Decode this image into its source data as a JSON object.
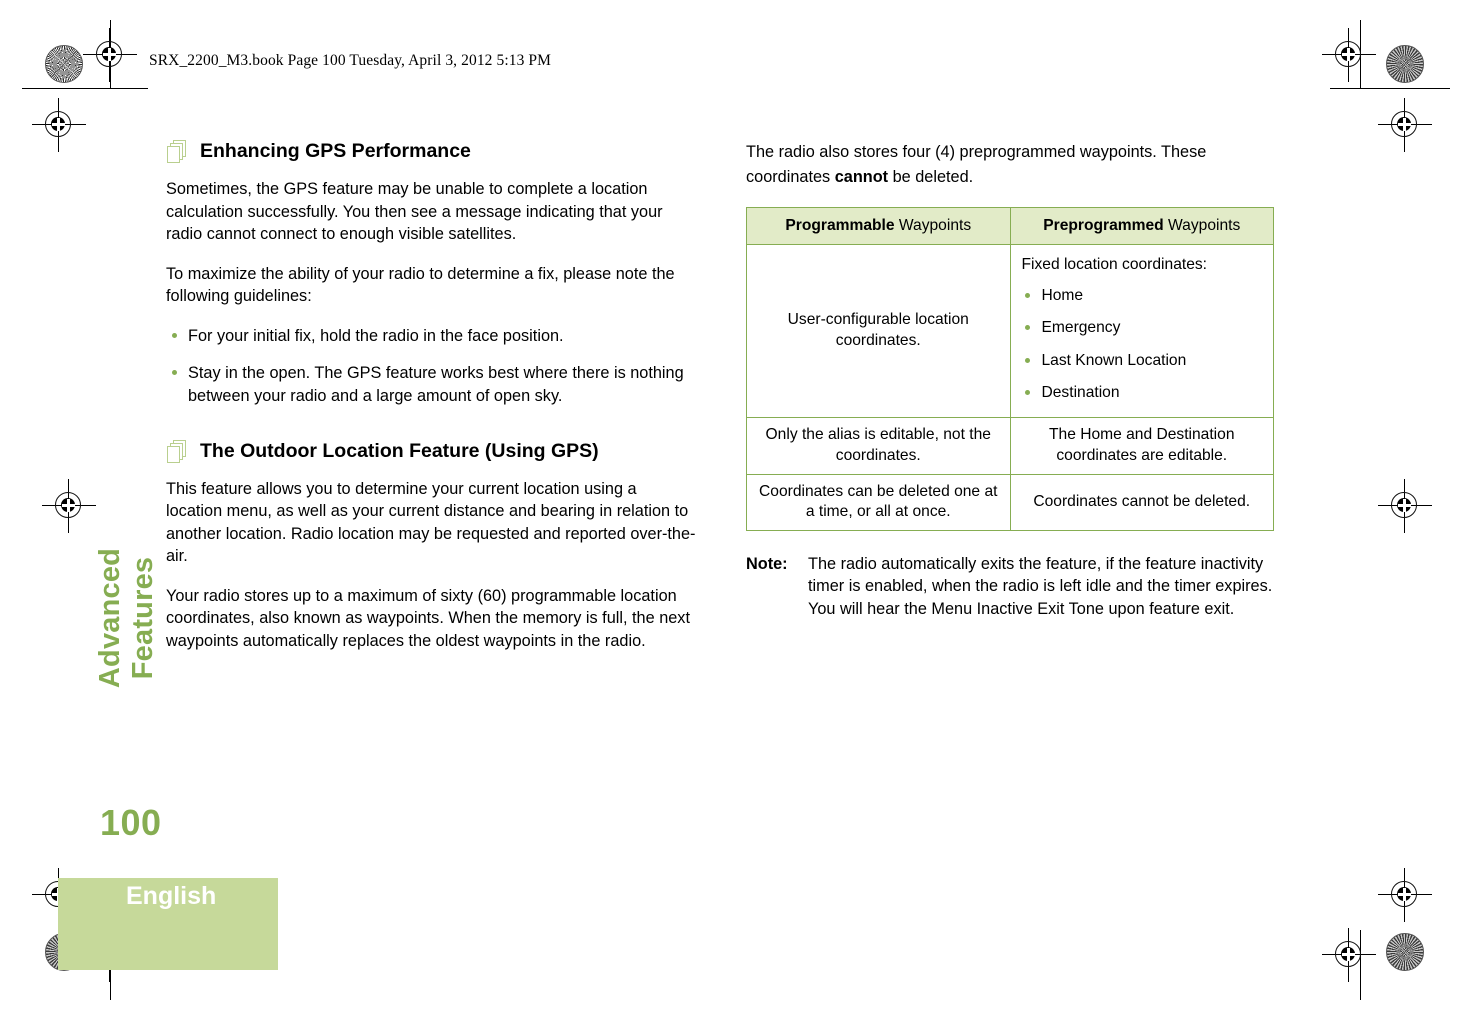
{
  "header": {
    "file_line": "SRX_2200_M3.book  Page 100  Tuesday, April 3, 2012  5:13 PM"
  },
  "sidebar": {
    "chapter_tab": "Advanced Features",
    "page_number": "100",
    "language": "English"
  },
  "colors": {
    "accent_green": "#86ad52",
    "tab_green": "#c6d99a",
    "table_header_green": "#e2ebc8",
    "icon_outline_green": "#b9cf8e"
  },
  "left_column": {
    "heading_1": "Enhancing GPS Performance",
    "para_1": "Sometimes, the GPS feature may be unable to complete a location calculation successfully. You then see a message indicating that your radio cannot connect to enough visible satellites.",
    "para_2": "To maximize the ability of your radio to determine a fix, please note the following guidelines:",
    "guidelines": [
      "For your initial fix, hold the radio in the face position.",
      "Stay in the open. The GPS feature works best where there is nothing between your radio and a large amount of open sky."
    ],
    "heading_2": "The Outdoor Location Feature (Using GPS)",
    "para_3": "This feature allows you to determine your current location using a location menu, as well as your current distance and bearing in relation to another location. Radio location may be requested and reported over-the-air.",
    "para_4": "Your radio stores up to a maximum of sixty (60) programmable location coordinates, also known as waypoints. When the memory is full, the next waypoints automatically replaces the oldest waypoints in the radio."
  },
  "right_column": {
    "intro_part_1": "The radio also stores four (4) preprogrammed waypoints. These coordinates ",
    "intro_bold": "cannot",
    "intro_part_2": " be deleted.",
    "table": {
      "headers": [
        {
          "bold": "Programmable",
          "rest": " Waypoints"
        },
        {
          "bold": "Preprogrammed",
          "rest": " Waypoints"
        }
      ],
      "row_1": {
        "left": "User-configurable location coordinates.",
        "right_lead": "Fixed location coordinates:",
        "right_items": [
          "Home",
          "Emergency",
          "Last Known Location",
          "Destination"
        ]
      },
      "row_2": {
        "left": "Only the alias is editable, not the coordinates.",
        "right": "The Home and Destination coordinates are editable."
      },
      "row_3": {
        "left": "Coordinates can be deleted one at a time, or all at once.",
        "right": "Coordinates cannot be deleted."
      }
    },
    "note": {
      "label": "Note:",
      "text": "The radio automatically exits the feature, if the feature inactivity timer is enabled, when the radio is left idle and the timer expires. You will hear the Menu Inactive Exit Tone upon feature exit."
    }
  }
}
